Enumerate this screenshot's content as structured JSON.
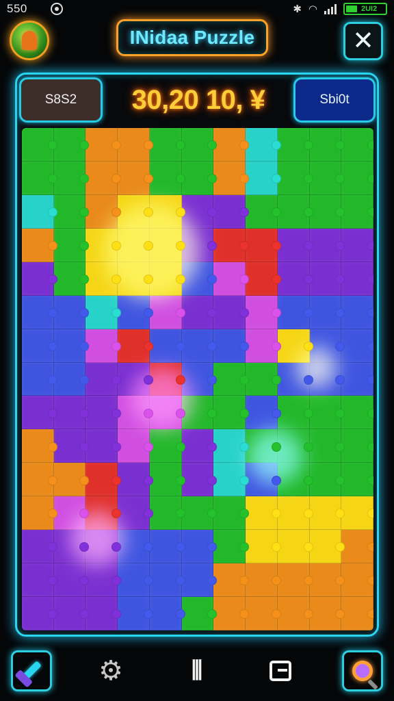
{
  "status_bar": {
    "time": "550",
    "battery_label": "2UI2",
    "battery_color": "#2fd12f"
  },
  "header": {
    "title": "INidaa Puzzle",
    "close_label": "✕",
    "avatar_icon": "acorn-icon"
  },
  "score_bar": {
    "left_label": "S8S2",
    "score": "30,20 10, ¥",
    "right_label": "Sbi0t"
  },
  "colors": {
    "accent": "#29d7f2",
    "title_border": "#ffa126",
    "score_glow": "#ffcf3a"
  },
  "board": {
    "columns": 11,
    "rows": 15,
    "palette": {
      "G": "#22b82a",
      "O": "#e98a1a",
      "Y": "#f5d514",
      "P": "#7a2fd0",
      "B": "#3f55e0",
      "R": "#e0302a",
      "C": "#27d2c8",
      "M": "#d04ee0",
      "V": "#5a3ae0"
    },
    "grid": [
      "GGOOGGOCGGG",
      "GGOOGGOCGGG",
      "CGOYYPPGGGG",
      "OGYYYPRRPPP",
      "PGYYYBMRPPP",
      "BBCBMPPMBBB",
      "BBMRBBBMYBB",
      "BBPPRBGGBBB",
      "PPPMMGGBGGG",
      "OPPMGPCGGGG",
      "OORPGPCBGGG",
      "OMRPGGGYYYY",
      "PPPBBBGYYYO",
      "PPPBBBOOOOO",
      "PPPBBGOOOOO"
    ],
    "glows": [
      {
        "color": "#fff36a"
      },
      {
        "color": "#ff6af0"
      },
      {
        "color": "#ffff8a"
      },
      {
        "color": "#7affff"
      },
      {
        "color": "#ff9cff"
      }
    ]
  },
  "bottom_nav": {
    "items": [
      {
        "icon": "hammer-icon"
      },
      {
        "icon": "gear-puzzle-icon"
      },
      {
        "icon": "columns-icon",
        "label": "⫴"
      },
      {
        "icon": "box-icon"
      },
      {
        "icon": "magnifier-icon"
      }
    ]
  }
}
